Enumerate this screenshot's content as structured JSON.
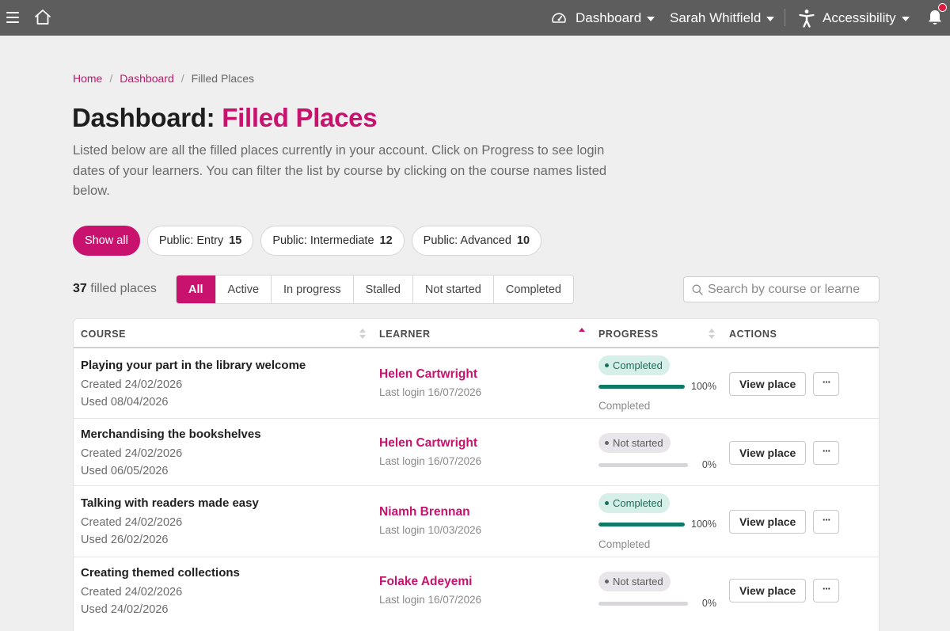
{
  "topbar": {
    "dashboard_label": "Dashboard",
    "user_label": "Sarah Whitfield",
    "accessibility_label": "Accessibility",
    "icons": [
      "menu-icon",
      "home-icon",
      "dashboard-gauge-icon",
      "accessibility-person-icon",
      "bell-icon"
    ]
  },
  "breadcrumb": {
    "home": "Home",
    "dashboard": "Dashboard",
    "current": "Filled Places",
    "separator": "/"
  },
  "page": {
    "title_prefix": "Dashboard:",
    "title_accent": "Filled Places",
    "intro": "Listed below are all the filled places currently in your account. Click on Progress to see login dates of your learners. You can filter the list by course by clicking on the course names listed below."
  },
  "course_filters": [
    {
      "label": "Show all",
      "count": null,
      "active": true
    },
    {
      "label": "Public: Entry",
      "count": "15",
      "active": false
    },
    {
      "label": "Public: Intermediate",
      "count": "12",
      "active": false
    },
    {
      "label": "Public: Advanced",
      "count": "10",
      "active": false
    }
  ],
  "summary": {
    "count": "37",
    "count_label": "filled places"
  },
  "status_tabs": [
    {
      "label": "All",
      "active": true
    },
    {
      "label": "Active",
      "active": false
    },
    {
      "label": "In progress",
      "active": false
    },
    {
      "label": "Stalled",
      "active": false
    },
    {
      "label": "Not started",
      "active": false
    },
    {
      "label": "Completed",
      "active": false
    }
  ],
  "search": {
    "placeholder": "Search by course or learne"
  },
  "table": {
    "columns": {
      "course": "COURSE",
      "learner": "LEARNER",
      "progress": "PROGRESS",
      "actions": "ACTIONS"
    },
    "sorted_column": "learner",
    "sort_direction": "asc",
    "rows": [
      {
        "course": "Playing your part in the library welcome",
        "created": "Created 24/02/2026",
        "used": "Used 08/04/2026",
        "learner": "Helen Cartwright",
        "last_login": "Last login 16/07/2026",
        "badge": "Completed",
        "badge_type": "done",
        "progress": 1.0,
        "progress_text": "100%",
        "status_text": "Completed",
        "view_label": "View place",
        "more_label": "···"
      },
      {
        "course": "Merchandising the bookshelves",
        "created": "Created 24/02/2026",
        "used": "Used 06/05/2026",
        "learner": "Helen Cartwright",
        "last_login": "Last login 16/07/2026",
        "badge": "Not started",
        "badge_type": "notyet",
        "progress": 0,
        "progress_text": "0%",
        "status_text": "",
        "view_label": "View place",
        "more_label": "···"
      },
      {
        "course": "Talking with readers made easy",
        "created": "Created 24/02/2026",
        "used": "Used 26/02/2026",
        "learner": "Niamh Brennan",
        "last_login": "Last login 10/03/2026",
        "badge": "Completed",
        "badge_type": "done",
        "progress": 1.0,
        "progress_text": "100%",
        "status_text": "Completed",
        "view_label": "View place",
        "more_label": "···"
      },
      {
        "course": "Creating themed collections",
        "created": "Created 24/02/2026",
        "used": "Used 24/02/2026",
        "learner": "Folake Adeyemi",
        "last_login": "Last login 16/07/2026",
        "badge": "Not started",
        "badge_type": "notyet",
        "progress": 0,
        "progress_text": "0%",
        "status_text": "",
        "view_label": "View place",
        "more_label": "···"
      }
    ]
  },
  "colors": {
    "topbar": "#5d5d5d",
    "accent": "#c8126e",
    "completed_bar": "#0f7a66",
    "completed_badge_bg": "#d6efe9",
    "notstarted_badge_bg": "#e8e6ea",
    "notification_dot": "#e0193f"
  }
}
